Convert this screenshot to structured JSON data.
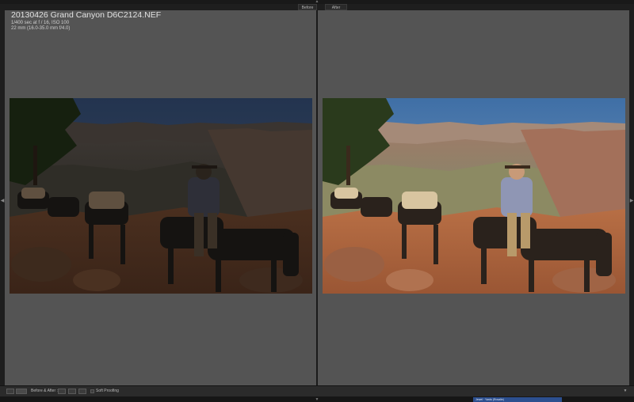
{
  "view_labels": {
    "before": "Before",
    "after": "After"
  },
  "info_overlay": {
    "title": "20130426 Grand Canyon D6C2124.NEF",
    "line1": "1/400 sec at f / 16, ISO 100",
    "line2": "22 mm (16.0-35.0 mm f/4.0)"
  },
  "toolbar": {
    "before_after_label": "Before & After :",
    "soft_proofing_label": "Soft Proofing"
  },
  "filmstrip": {
    "text": "Jewel · Yards (Rosalie)"
  },
  "colors": {
    "pane_bg": "#545454",
    "app_bg": "#1e1e1e",
    "accent": "#2c4f8f"
  }
}
